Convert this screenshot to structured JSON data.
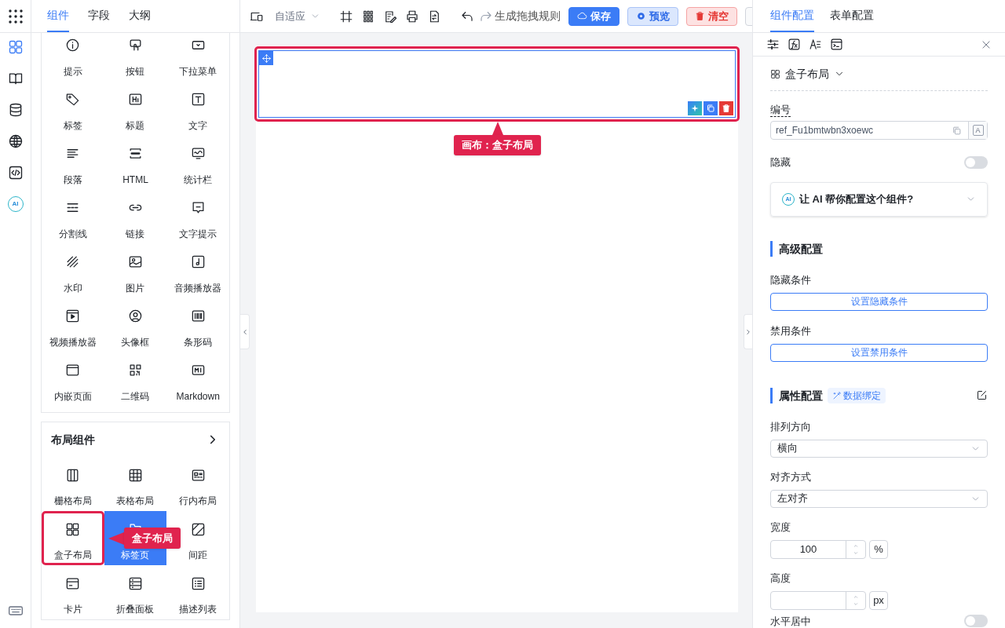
{
  "rail": {
    "items": [
      {
        "kind": "components",
        "selected": true
      },
      {
        "kind": "book",
        "selected": false
      },
      {
        "kind": "database",
        "selected": false
      },
      {
        "kind": "globe",
        "selected": false
      },
      {
        "kind": "code",
        "selected": false
      },
      {
        "kind": "ai",
        "label": "AI",
        "selected": false
      }
    ]
  },
  "left_panel": {
    "tabs": [
      {
        "label": "组件",
        "selected": true
      },
      {
        "label": "字段",
        "selected": false
      },
      {
        "label": "大纲",
        "selected": false
      }
    ],
    "basic_components": [
      {
        "label": "提示",
        "kind": "info"
      },
      {
        "label": "按钮",
        "kind": "button"
      },
      {
        "label": "下拉菜单",
        "kind": "select"
      },
      {
        "label": "标签",
        "kind": "tag"
      },
      {
        "label": "标题",
        "kind": "heading"
      },
      {
        "label": "文字",
        "kind": "text"
      },
      {
        "label": "段落",
        "kind": "paragraph"
      },
      {
        "label": "HTML",
        "kind": "html"
      },
      {
        "label": "统计栏",
        "kind": "stat"
      },
      {
        "label": "分割线",
        "kind": "divider"
      },
      {
        "label": "链接",
        "kind": "link"
      },
      {
        "label": "文字提示",
        "kind": "tooltip"
      },
      {
        "label": "水印",
        "kind": "watermark"
      },
      {
        "label": "图片",
        "kind": "image"
      },
      {
        "label": "音频播放器",
        "kind": "audio"
      },
      {
        "label": "视频播放器",
        "kind": "video"
      },
      {
        "label": "头像框",
        "kind": "avatar"
      },
      {
        "label": "条形码",
        "kind": "barcode"
      },
      {
        "label": "内嵌页面",
        "kind": "iframe"
      },
      {
        "label": "二维码",
        "kind": "qrcode"
      },
      {
        "label": "Markdown",
        "kind": "markdown"
      }
    ],
    "layout_section": {
      "title": "布局组件",
      "callout": "盒子布局",
      "items": [
        {
          "label": "栅格布局",
          "kind": "grid",
          "selected": false,
          "highlighted": false
        },
        {
          "label": "表格布局",
          "kind": "table",
          "selected": false,
          "highlighted": false
        },
        {
          "label": "行内布局",
          "kind": "inline",
          "selected": false,
          "highlighted": false
        },
        {
          "label": "盒子布局",
          "kind": "box",
          "selected": false,
          "highlighted": true
        },
        {
          "label": "标签页",
          "kind": "tabs",
          "selected": true,
          "highlighted": false
        },
        {
          "label": "间距",
          "kind": "spacing",
          "selected": false,
          "highlighted": false
        },
        {
          "label": "卡片",
          "kind": "card",
          "selected": false,
          "highlighted": false
        },
        {
          "label": "折叠面板",
          "kind": "collapse",
          "selected": false,
          "highlighted": false
        },
        {
          "label": "描述列表",
          "kind": "desc",
          "selected": false,
          "highlighted": false
        }
      ]
    }
  },
  "toolbar": {
    "viewport": "自适应",
    "generate": "生成拖拽规则",
    "buttons": [
      {
        "label": "保存",
        "kind": "primary"
      },
      {
        "label": "预览",
        "kind": "preview"
      },
      {
        "label": "清空",
        "kind": "danger"
      }
    ]
  },
  "canvas": {
    "callout": "画布：盒子布局"
  },
  "right_panel": {
    "tabs": [
      {
        "label": "组件配置",
        "selected": true
      },
      {
        "label": "表单配置",
        "selected": false
      }
    ],
    "component_type": "盒子布局",
    "id_label": "编号",
    "id_value": "ref_Fu1bmtwbn3xoewc",
    "id_addon": "A",
    "hidden": {
      "label": "隐藏",
      "on": false
    },
    "ai_prompt": {
      "badge": "AI",
      "text": "让 AI 帮你配置这个组件?"
    },
    "advanced": {
      "title": "高级配置",
      "hide_label": "隐藏条件",
      "hide_button": "设置隐藏条件",
      "disable_label": "禁用条件",
      "disable_button": "设置禁用条件"
    },
    "properties": {
      "title": "属性配置",
      "binding": "数据绑定",
      "direction_label": "排列方向",
      "direction_value": "横向",
      "align_label": "对齐方式",
      "align_value": "左对齐",
      "width_label": "宽度",
      "width_value": "100",
      "width_unit": "%",
      "height_label": "高度",
      "height_unit": "px",
      "hcenter_label": "水平居中",
      "hcenter_on": false
    }
  }
}
